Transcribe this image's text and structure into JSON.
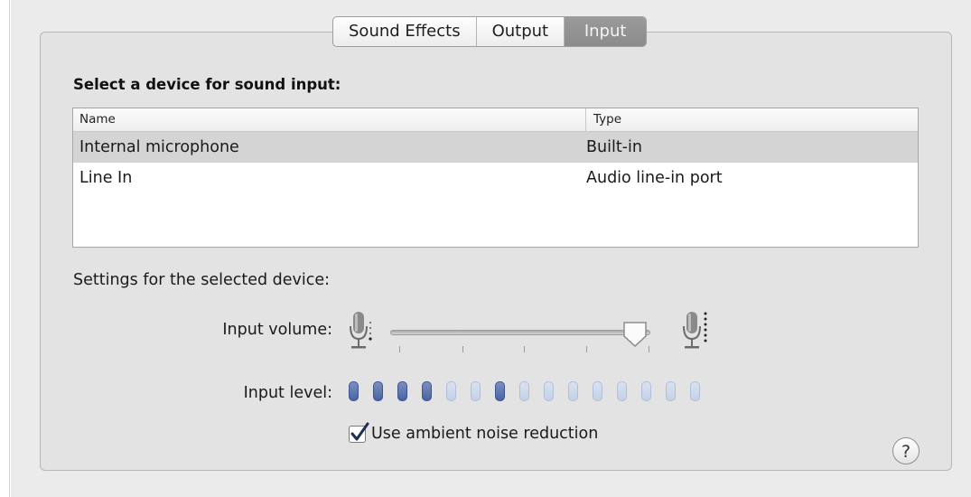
{
  "tabs": [
    {
      "label": "Sound Effects",
      "active": false
    },
    {
      "label": "Output",
      "active": false
    },
    {
      "label": "Input",
      "active": true
    }
  ],
  "device_section": {
    "title": "Select a device for sound input:",
    "columns": [
      "Name",
      "Type"
    ],
    "rows": [
      {
        "name": "Internal microphone",
        "type": "Built-in",
        "selected": true
      },
      {
        "name": "Line In",
        "type": "Audio line-in port",
        "selected": false
      }
    ]
  },
  "settings": {
    "title": "Settings for the selected device:",
    "input_volume_label": "Input volume:",
    "input_volume_value": 0.94,
    "input_level_label": "Input level:",
    "input_level_segments": [
      1,
      1,
      1,
      1,
      0,
      0,
      1,
      0,
      0,
      0,
      0,
      0,
      0,
      0,
      0
    ],
    "ambient_noise_label": "Use ambient noise reduction",
    "ambient_noise_checked": true
  },
  "help_button": {
    "label": "?"
  },
  "icons": {
    "volume_low": "microphone-low-icon",
    "volume_high": "microphone-high-icon",
    "help": "help-icon"
  },
  "colors": {
    "accent": "#4a63a3",
    "level_off": "#c4d0e6",
    "selected_row": "#d4d4d4",
    "active_tab": "#8f8f8f"
  }
}
